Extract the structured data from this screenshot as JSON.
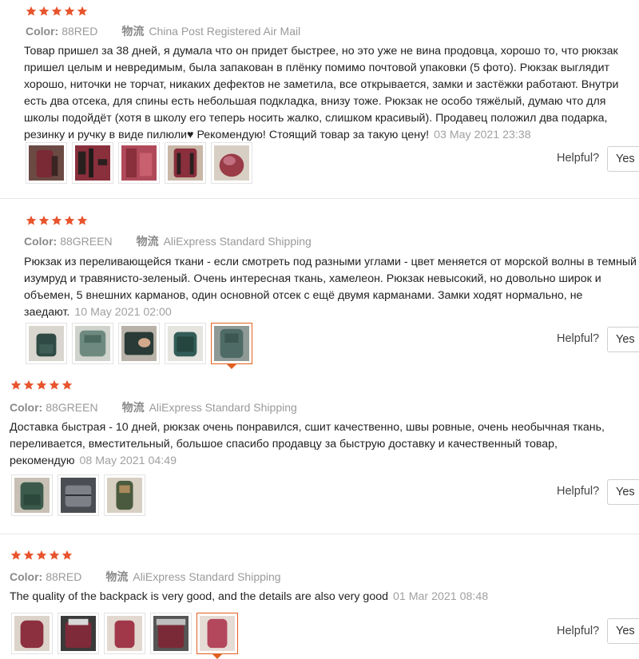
{
  "labels": {
    "color": "Color:",
    "shipping": "物流",
    "helpful": "Helpful?",
    "yes": "Yes"
  },
  "colors": {
    "star": "#e8542d",
    "accent": "#e06020"
  },
  "reviews": [
    {
      "stars": 5,
      "color": "88RED",
      "shipping": "China Post Registered Air Mail",
      "text": "Товар пришел за 38 дней, я думала что он придет быстрее, но это уже не вина продовца, хорошо то, что рюкзак пришел целым и невредимым, была запакован в плёнку помимо почтовой упаковки (5 фото). Рюкзак выглядит хорошо, ниточки не торчат, никаких дефектов не заметила, все открывается, замки и застёжки работают. Внутри есть два отсека, для спины есть небольшая подкладка, внизу тоже. Рюкзак не особо тяжёлый, думаю что для школы подойдёт (хотя в школу его теперь носить жалко, слишком красивый). Продавец положил два подарка, резинку и ручку в виде пилюли♥ Рекомендую! Стоящий товар за такую цену!",
      "date": "03 May 2021 23:38",
      "photos": [
        "burgundy-backpack-photo",
        "burgundy-backpack-photo",
        "burgundy-backpack-photo",
        "burgundy-backpack-photo",
        "burgundy-backpack-photo"
      ]
    },
    {
      "stars": 5,
      "color": "88GREEN",
      "shipping": "AliExpress Standard Shipping",
      "text": "Рюкзак из переливающейся ткани - если смотреть под разными углами - цвет меняется от морской волны в темный изумруд и травянисто-зеленый. Очень интересная ткань, хамелеон. Рюкзак невысокий, но довольно широк и объемен, 5 внешних карманов, один основной отсек с ещё двумя карманами. Замки ходят нормально, не заедают.",
      "date": "10 May 2021 02:00",
      "photos": [
        "green-backpack-photo",
        "green-backpack-photo",
        "green-backpack-photo",
        "green-backpack-photo",
        "green-backpack-photo"
      ]
    },
    {
      "stars": 5,
      "color": "88GREEN",
      "shipping": "AliExpress Standard Shipping",
      "text": "Доставка быстрая - 10 дней, рюкзак очень понравился, сшит качественно, швы ровные, очень необычная ткань, переливается, вместительный, большое спасибо продавцу за быструю доставку и качественный товар, рекомендую",
      "date": "08 May 2021 04:49",
      "photos": [
        "green-backpack-photo",
        "grey-backpack-photo",
        "green-backpack-photo"
      ]
    },
    {
      "stars": 5,
      "color": "88RED",
      "shipping": "AliExpress Standard Shipping",
      "text": "The quality of the backpack is very good, and the details are also very good",
      "date": "01 Mar 2021 08:48",
      "photos": [
        "burgundy-backpack-photo",
        "burgundy-backpack-photo",
        "burgundy-backpack-photo",
        "burgundy-backpack-photo",
        "burgundy-backpack-photo"
      ]
    }
  ]
}
